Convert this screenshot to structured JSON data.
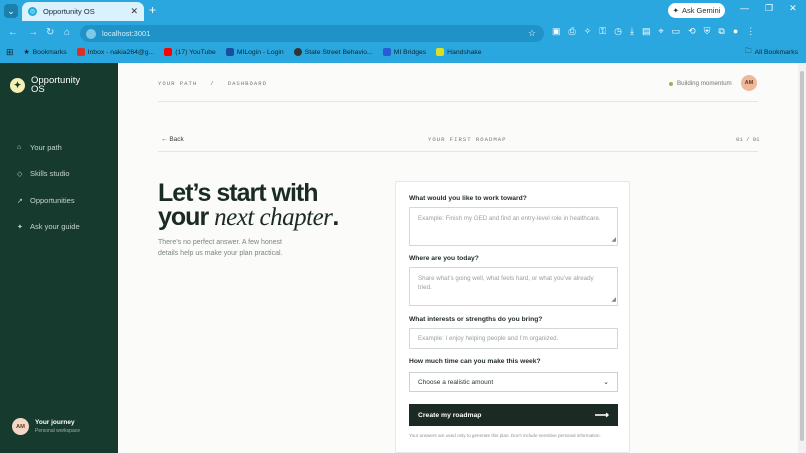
{
  "browser": {
    "tab_title": "Opportunity OS",
    "url": "localhost:3001",
    "gemini_label": "Ask Gemini",
    "bookmarks": [
      {
        "label": "Bookmarks",
        "color": "#222"
      },
      {
        "label": "Inbox - nakia264@g...",
        "color": "#d93025"
      },
      {
        "label": "(17) YouTube",
        "color": "#ff0000"
      },
      {
        "label": "MILogin - Login",
        "color": "#1a4fa0"
      },
      {
        "label": "State Street Behavio...",
        "color": "#333333"
      },
      {
        "label": "MI Bridges",
        "color": "#2a5bd7"
      },
      {
        "label": "Handshake",
        "color": "#d9e021"
      }
    ],
    "all_bookmarks": "All Bookmarks"
  },
  "sidebar": {
    "brand": "Opportunity OS",
    "items": [
      {
        "label": "Your path",
        "icon": "⌂"
      },
      {
        "label": "Skills studio",
        "icon": "◇"
      },
      {
        "label": "Opportunities",
        "icon": "↗"
      },
      {
        "label": "Ask your guide",
        "icon": "✦"
      }
    ],
    "user_initials": "AM",
    "journey_title": "Your journey",
    "journey_sub": "Personal workspace"
  },
  "header": {
    "breadcrumb": "YOUR PATH   /   DASHBOARD",
    "status": "Building momentum",
    "avatar_initials": "AM"
  },
  "roadmap": {
    "back": "Back",
    "section": "YOUR FIRST ROADMAP",
    "pager": "01 / 01"
  },
  "hero": {
    "line1": "Let’s start with",
    "line2_plain": "your",
    "line2_italic": "next chapter",
    "period": ".",
    "sub": "There’s no perfect answer. A few honest details help us make your plan practical."
  },
  "form": {
    "q1": "What would you like to work toward?",
    "q1_placeholder": "Example: Finish my GED and find an entry-level role in healthcare.",
    "q2": "Where are you today?",
    "q2_placeholder": "Share what’s going well, what feels hard, or what you’ve already tried.",
    "q3": "What interests or strengths do you bring?",
    "q3_placeholder": "Example: I enjoy helping people and I’m organized.",
    "q4": "How much time can you make this week?",
    "q4_value": "Choose a realistic amount",
    "submit": "Create my roadmap",
    "fine": "Your answers are used only to generate this plan. Don’t include sensitive personal information."
  }
}
